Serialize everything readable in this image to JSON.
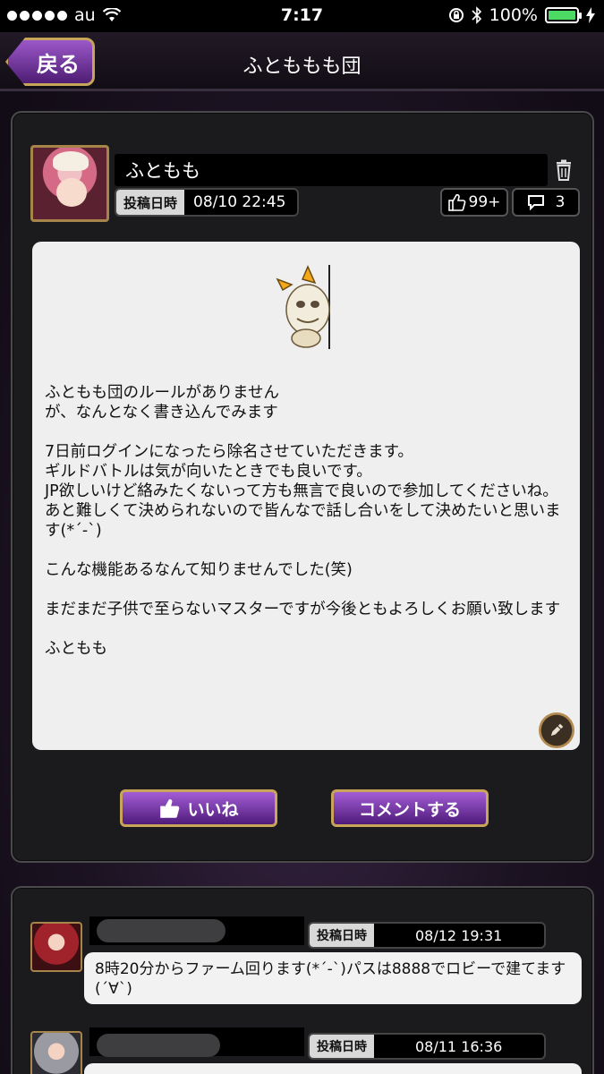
{
  "status_bar": {
    "carrier": "au",
    "time": "7:17",
    "battery": "100%",
    "battery_level": 1.0
  },
  "header": {
    "back_label": "戻る",
    "title": "ふとももも団"
  },
  "post": {
    "author": "ふともも",
    "date_label": "投稿日時",
    "date": "08/10 22:45",
    "likes": "99+",
    "comments": "3",
    "body": "ふともも団のルールがありません\nが、なんとなく書き込んでみます\n\n7日前ログインになったら除名させていただきます。\nギルドバトルは気が向いたときでも良いです。\nJP欲しいけど絡みたくないって方も無言で良いので参加してくださいね。\nあと難しくて決められないので皆んなで話し合いをして決めたいと思います(*´-`)\n\nこんな機能あるなんて知りませんでした(笑)\n\nまだまだ子供で至らないマスターですが今後ともよろしくお願い致します\n\nふともも",
    "like_button": "いいね",
    "comment_button": "コメントする"
  },
  "comments": [
    {
      "date_label": "投稿日時",
      "date": "08/12 19:31",
      "text": "8時20分からファーム回ります(*´-`)パスは8888でロビーで建てます(´∀`)"
    },
    {
      "date_label": "投稿日時",
      "date": "08/11 16:36",
      "text": ""
    }
  ],
  "colors": {
    "button_purple": "#7b3aa8",
    "button_border_gold": "#c9a55a",
    "panel_bg": "#1b1b1d"
  }
}
